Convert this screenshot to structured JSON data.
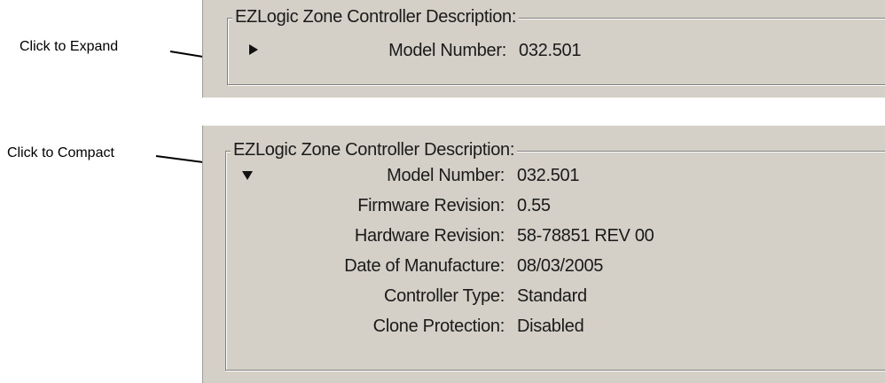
{
  "callouts": {
    "expand": "Click to Expand",
    "compact": "Click to Compact"
  },
  "collapsed_panel": {
    "group_title": "EZLogic Zone Controller Description:",
    "toggle_icon": "triangle-right-icon",
    "row": {
      "label": "Model Number:",
      "value": "032.501"
    }
  },
  "expanded_panel": {
    "group_title": "EZLogic Zone Controller Description:",
    "toggle_icon": "triangle-down-icon",
    "rows": [
      {
        "label": "Model Number:",
        "value": "032.501"
      },
      {
        "label": "Firmware Revision:",
        "value": "0.55"
      },
      {
        "label": "Hardware Revision:",
        "value": "58-78851 REV 00"
      },
      {
        "label": "Date of Manufacture:",
        "value": "08/03/2005"
      },
      {
        "label": "Controller Type:",
        "value": "Standard"
      },
      {
        "label": "Clone Protection:",
        "value": "Disabled"
      }
    ]
  },
  "colors": {
    "panel_background": "#d4d0c8",
    "text": "#1a1a1a",
    "callout_text": "#000000"
  }
}
